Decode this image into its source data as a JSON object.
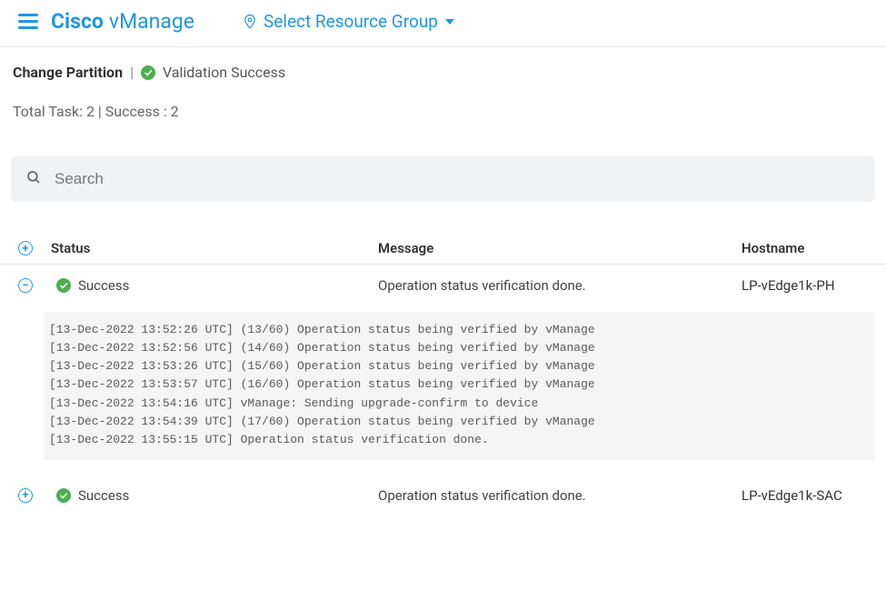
{
  "header": {
    "brand_cisco": "Cisco",
    "brand_vmanage": "vManage",
    "resource_label": "Select Resource Group"
  },
  "summary": {
    "title": "Change Partition",
    "pipe": "|",
    "validation_status": "Validation Success",
    "counts": "Total Task: 2 | Success : 2"
  },
  "search": {
    "placeholder": "Search"
  },
  "table": {
    "headers": {
      "status": "Status",
      "message": "Message",
      "hostname": "Hostname"
    },
    "rows": [
      {
        "expand_glyph": "−",
        "status": "Success",
        "message": "Operation status verification done.",
        "hostname": "LP-vEdge1k-PH",
        "expanded": true,
        "log": [
          "[13-Dec-2022 13:52:26 UTC] (13/60) Operation status being verified by vManage",
          "[13-Dec-2022 13:52:56 UTC] (14/60) Operation status being verified by vManage",
          "[13-Dec-2022 13:53:26 UTC] (15/60) Operation status being verified by vManage",
          "[13-Dec-2022 13:53:57 UTC] (16/60) Operation status being verified by vManage",
          "[13-Dec-2022 13:54:16 UTC] vManage: Sending upgrade-confirm to device",
          "[13-Dec-2022 13:54:39 UTC] (17/60) Operation status being verified by vManage",
          "[13-Dec-2022 13:55:15 UTC] Operation status verification done."
        ]
      },
      {
        "expand_glyph": "+",
        "status": "Success",
        "message": "Operation status verification done.",
        "hostname": "LP-vEdge1k-SAC",
        "expanded": false,
        "log": []
      }
    ]
  },
  "colors": {
    "accent": "#2196e3",
    "success": "#4caf50"
  }
}
